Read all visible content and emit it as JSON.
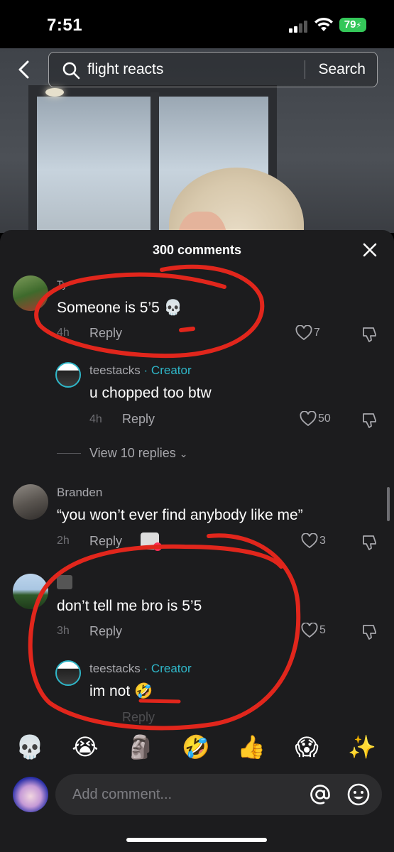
{
  "status_bar": {
    "time": "7:51",
    "battery": "79"
  },
  "search": {
    "query": "flight reacts",
    "button_label": "Search"
  },
  "comments_sheet": {
    "title": "300 comments",
    "comments": [
      {
        "username": "Ty",
        "text": "Someone is 5’5 💀",
        "time": "4h",
        "reply_label": "Reply",
        "likes": "7",
        "replies": [
          {
            "username": "teestacks",
            "badge": "· Creator",
            "text": "u chopped too btw",
            "time": "4h",
            "reply_label": "Reply",
            "likes": "50"
          }
        ],
        "view_replies": "View 10 replies"
      },
      {
        "username": "Branden",
        "text": "“you won’t ever find anybody like me”",
        "time": "2h",
        "reply_label": "Reply",
        "likes": "3"
      },
      {
        "username": "",
        "text": "don’t tell me bro is 5’5",
        "time": "3h",
        "reply_label": "Reply",
        "likes": "5",
        "replies": [
          {
            "username": "teestacks",
            "badge": "· Creator",
            "text": "im not 🤣",
            "time": "",
            "reply_label": "Reply"
          }
        ]
      }
    ]
  },
  "emoji_bar": [
    "💀",
    "😭",
    "🗿",
    "🤣",
    "👍",
    "😱",
    "✨"
  ],
  "composer": {
    "placeholder": "Add comment..."
  },
  "colors": {
    "sheet_bg": "#1c1c1e",
    "creator_accent": "#2fb7c9",
    "annotation_red": "#e1261c",
    "battery_green": "#34c759"
  }
}
